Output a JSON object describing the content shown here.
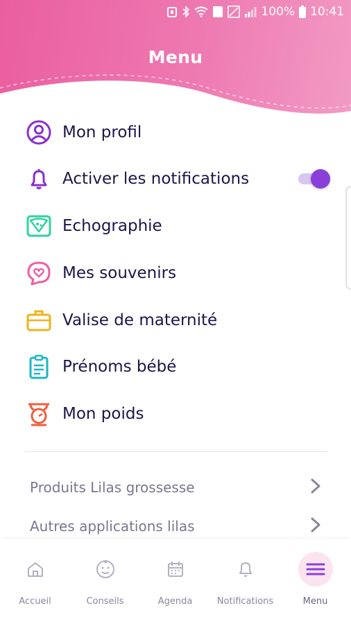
{
  "status_bar": {
    "battery": "100%",
    "time": "10:41",
    "sim_badge": "1"
  },
  "header": {
    "title": "Menu"
  },
  "menu_items": [
    {
      "label": "Mon profil",
      "icon": "user-circle-icon",
      "color": "#8a2fd0"
    },
    {
      "label": "Activer les notifications",
      "icon": "bell-icon",
      "color": "#8a2fd0",
      "toggle_on": true
    },
    {
      "label": "Echographie",
      "icon": "ultrasound-icon",
      "color": "#2ed3a0"
    },
    {
      "label": "Mes souvenirs",
      "icon": "heart-bubble-icon",
      "color": "#ee5ea5"
    },
    {
      "label": "Valise de maternité",
      "icon": "suitcase-icon",
      "color": "#f2b21b"
    },
    {
      "label": "Prénoms bébé",
      "icon": "clipboard-icon",
      "color": "#1bb6c9"
    },
    {
      "label": "Mon poids",
      "icon": "scale-icon",
      "color": "#f05d3b"
    }
  ],
  "links": [
    {
      "label": "Produits Lilas grossesse"
    },
    {
      "label": "Autres applications lilas"
    }
  ],
  "bottom_nav": [
    {
      "label": "Accueil",
      "icon": "home-icon"
    },
    {
      "label": "Conseils",
      "icon": "baby-face-icon"
    },
    {
      "label": "Agenda",
      "icon": "calendar-icon"
    },
    {
      "label": "Notifications",
      "icon": "bell-icon"
    },
    {
      "label": "Menu",
      "icon": "hamburger-icon",
      "active": true
    }
  ],
  "colors": {
    "header_pink": "#ea5ea0",
    "accent_purple": "#8b3fd9",
    "text_dark": "#1d1547",
    "text_muted": "#7b7690"
  }
}
